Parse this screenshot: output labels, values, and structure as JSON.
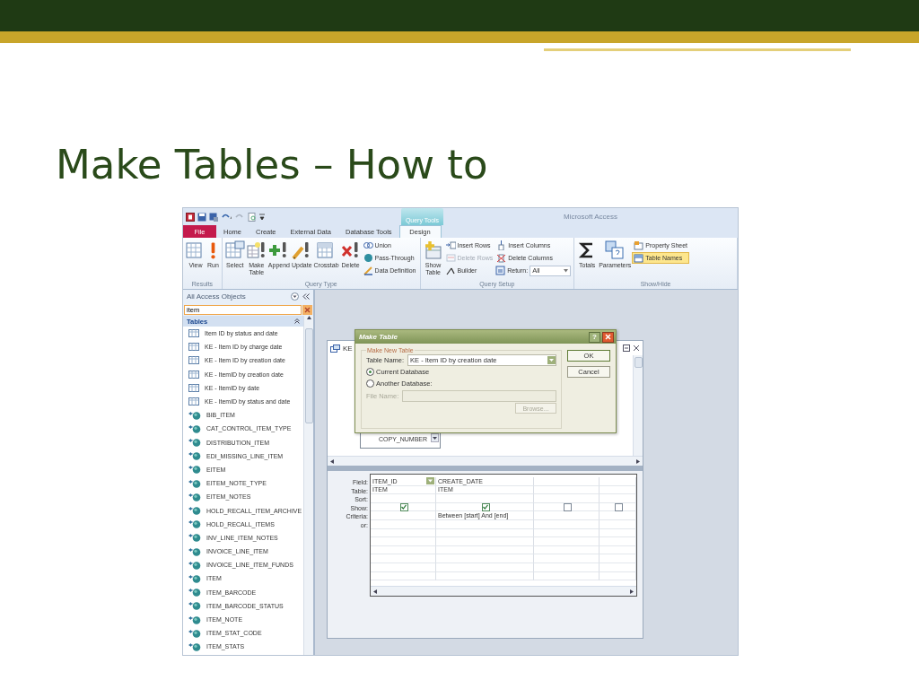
{
  "slide": {
    "title": "Make Tables – How to"
  },
  "app": {
    "title": "Microsoft Access",
    "context_tab_group": "Query Tools",
    "tabs": [
      {
        "label": "File",
        "kind": "file",
        "selected": false
      },
      {
        "label": "Home",
        "kind": "normal",
        "selected": false
      },
      {
        "label": "Create",
        "kind": "normal",
        "selected": false
      },
      {
        "label": "External Data",
        "kind": "normal",
        "selected": false
      },
      {
        "label": "Database Tools",
        "kind": "normal",
        "selected": false
      },
      {
        "label": "Design",
        "kind": "normal",
        "selected": true
      }
    ],
    "ribbon_groups": [
      {
        "label": "Results",
        "buttons": [
          {
            "label": "View",
            "kind": "large",
            "disabled": false,
            "on": false
          },
          {
            "label": "Run",
            "kind": "large",
            "disabled": false,
            "on": false
          }
        ]
      },
      {
        "label": "Query Type",
        "buttons": [
          {
            "label": "Select",
            "kind": "large",
            "disabled": false,
            "on": false
          },
          {
            "label": "Make Table",
            "kind": "large",
            "disabled": false,
            "on": false
          },
          {
            "label": "Append",
            "kind": "large",
            "disabled": false,
            "on": false
          },
          {
            "label": "Update",
            "kind": "large",
            "disabled": false,
            "on": false
          },
          {
            "label": "Crosstab",
            "kind": "large",
            "disabled": false,
            "on": false
          },
          {
            "label": "Delete",
            "kind": "large",
            "disabled": false,
            "on": false
          },
          {
            "label": "Union",
            "kind": "small",
            "disabled": false,
            "on": false
          },
          {
            "label": "Pass-Through",
            "kind": "small",
            "disabled": false,
            "on": false
          },
          {
            "label": "Data Definition",
            "kind": "small",
            "disabled": false,
            "on": false
          }
        ]
      },
      {
        "label": "Query Setup",
        "buttons": [
          {
            "label": "Show Table",
            "kind": "large",
            "disabled": false,
            "on": false
          },
          {
            "label": "Insert Rows",
            "kind": "small",
            "disabled": false,
            "on": false
          },
          {
            "label": "Delete Rows",
            "kind": "small",
            "disabled": true,
            "on": false
          },
          {
            "label": "Builder",
            "kind": "small",
            "disabled": false,
            "on": false
          },
          {
            "label": "Insert Columns",
            "kind": "small",
            "disabled": false,
            "on": false
          },
          {
            "label": "Delete Columns",
            "kind": "small",
            "disabled": false,
            "on": false
          },
          {
            "label": "Return:",
            "kind": "combo",
            "value": "All",
            "disabled": false,
            "on": false
          }
        ]
      },
      {
        "label": "Show/Hide",
        "buttons": [
          {
            "label": "Totals",
            "kind": "large",
            "disabled": false,
            "on": false
          },
          {
            "label": "Parameters",
            "kind": "large",
            "disabled": false,
            "on": false
          },
          {
            "label": "Property Sheet",
            "kind": "small",
            "disabled": false,
            "on": false
          },
          {
            "label": "Table Names",
            "kind": "small",
            "disabled": false,
            "on": true
          }
        ]
      }
    ]
  },
  "navigation": {
    "header": "All Access Objects",
    "search": "item",
    "section": "Tables",
    "items": [
      {
        "label": "Item ID by status and date",
        "kind": "query"
      },
      {
        "label": "KE - Item ID by charge date",
        "kind": "query"
      },
      {
        "label": "KE - Item ID by creation date",
        "kind": "query"
      },
      {
        "label": "KE - ItemID by creation date",
        "kind": "query"
      },
      {
        "label": "KE - ItemID by date",
        "kind": "query"
      },
      {
        "label": "KE - ItemID by status and date",
        "kind": "query"
      },
      {
        "label": "BIB_ITEM",
        "kind": "linked"
      },
      {
        "label": "CAT_CONTROL_ITEM_TYPE",
        "kind": "linked"
      },
      {
        "label": "DISTRIBUTION_ITEM",
        "kind": "linked"
      },
      {
        "label": "EDI_MISSING_LINE_ITEM",
        "kind": "linked"
      },
      {
        "label": "EITEM",
        "kind": "linked"
      },
      {
        "label": "EITEM_NOTE_TYPE",
        "kind": "linked"
      },
      {
        "label": "EITEM_NOTES",
        "kind": "linked"
      },
      {
        "label": "HOLD_RECALL_ITEM_ARCHIVE",
        "kind": "linked"
      },
      {
        "label": "HOLD_RECALL_ITEMS",
        "kind": "linked"
      },
      {
        "label": "INV_LINE_ITEM_NOTES",
        "kind": "linked"
      },
      {
        "label": "INVOICE_LINE_ITEM",
        "kind": "linked"
      },
      {
        "label": "INVOICE_LINE_ITEM_FUNDS",
        "kind": "linked"
      },
      {
        "label": "ITEM",
        "kind": "linked"
      },
      {
        "label": "ITEM_BARCODE",
        "kind": "linked"
      },
      {
        "label": "ITEM_BARCODE_STATUS",
        "kind": "linked"
      },
      {
        "label": "ITEM_NOTE",
        "kind": "linked"
      },
      {
        "label": "ITEM_STAT_CODE",
        "kind": "linked"
      },
      {
        "label": "ITEM_STATS",
        "kind": "linked"
      }
    ]
  },
  "query_window": {
    "title": "KE",
    "field_list": [
      "COPY_NUMBER"
    ],
    "row_labels": [
      "Field:",
      "Table:",
      "Sort:",
      "Show:",
      "Criteria:",
      "or:"
    ],
    "columns": [
      {
        "field": "ITEM_ID",
        "table": "ITEM",
        "show": true,
        "active": true
      },
      {
        "field": "CREATE_DATE",
        "table": "ITEM",
        "show": true,
        "criteria": "Between [start] And [end]",
        "active": false
      },
      {
        "show": false,
        "active": false
      },
      {
        "show": false,
        "active": false
      }
    ]
  },
  "dialog": {
    "title": "Make Table",
    "help_button": "?",
    "group": "Make New Table",
    "table_name_label": "Table Name:",
    "table_name": "KE - Item ID by creation date",
    "radios": [
      {
        "label": "Current Database",
        "selected": true
      },
      {
        "label": "Another Database:",
        "selected": false
      }
    ],
    "file_name_label": "File Name:",
    "file_name_disabled": true,
    "browse": {
      "label": "Browse...",
      "disabled": true
    },
    "buttons": [
      "OK",
      "Cancel"
    ]
  }
}
